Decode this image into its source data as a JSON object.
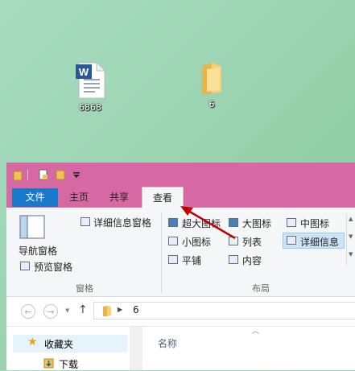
{
  "desktop": {
    "icons": [
      {
        "label": "6868",
        "icon": "word-document-icon"
      },
      {
        "label": "6",
        "icon": "folder-icon"
      }
    ]
  },
  "window": {
    "accent": "#d668a3",
    "tabs": {
      "file": "文件",
      "home": "主页",
      "share": "共享",
      "view": "查看"
    },
    "ribbon": {
      "details_pane": "详细信息窗格",
      "nav_pane": "导航窗格",
      "preview_pane": "预览窗格",
      "panes_group": "窗格",
      "extra_large": "超大图标",
      "large": "大图标",
      "medium": "中图标",
      "small": "小图标",
      "list": "列表",
      "details": "详细信息",
      "tiles": "平铺",
      "content": "内容",
      "layout_group": "布局"
    },
    "address": {
      "path": "6"
    },
    "sidebar": {
      "favorites": "收藏夹",
      "downloads": "下载"
    },
    "list_header": {
      "name": "名称"
    }
  }
}
